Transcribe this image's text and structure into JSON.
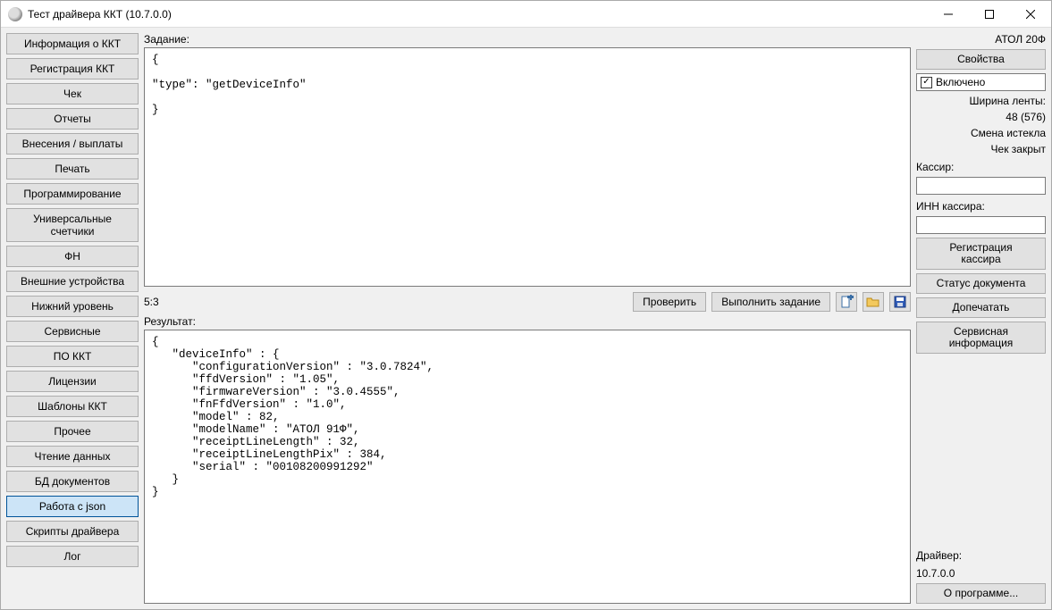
{
  "window": {
    "title": "Тест драйвера ККТ (10.7.0.0)"
  },
  "sidebar": {
    "items": [
      {
        "label": "Информация о ККТ"
      },
      {
        "label": "Регистрация ККТ"
      },
      {
        "label": "Чек"
      },
      {
        "label": "Отчеты"
      },
      {
        "label": "Внесения / выплаты"
      },
      {
        "label": "Печать"
      },
      {
        "label": "Программирование"
      },
      {
        "label": "Универсальные счетчики"
      },
      {
        "label": "ФН"
      },
      {
        "label": "Внешние устройства"
      },
      {
        "label": "Нижний уровень"
      },
      {
        "label": "Сервисные"
      },
      {
        "label": "ПО ККТ"
      },
      {
        "label": "Лицензии"
      },
      {
        "label": "Шаблоны ККТ"
      },
      {
        "label": "Прочее"
      },
      {
        "label": "Чтение данных"
      },
      {
        "label": "БД документов"
      },
      {
        "label": "Работа с json"
      },
      {
        "label": "Скрипты драйвера"
      },
      {
        "label": "Лог"
      }
    ],
    "active_index": 18
  },
  "center": {
    "task_label": "Задание:",
    "task_text": "{\n\n\"type\": \"getDeviceInfo\"\n\n}",
    "cursor_pos": "5:3",
    "validate_btn": "Проверить",
    "execute_btn": "Выполнить задание",
    "result_label": "Результат:",
    "result_text": "{\n   \"deviceInfo\" : {\n      \"configurationVersion\" : \"3.0.7824\",\n      \"ffdVersion\" : \"1.05\",\n      \"firmwareVersion\" : \"3.0.4555\",\n      \"fnFfdVersion\" : \"1.0\",\n      \"model\" : 82,\n      \"modelName\" : \"АТОЛ 91Ф\",\n      \"receiptLineLength\" : 32,\n      \"receiptLineLengthPix\" : 384,\n      \"serial\" : \"00108200991292\"\n   }\n}"
  },
  "right": {
    "device_name": "АТОЛ 20Ф",
    "properties_btn": "Свойства",
    "enabled_label": "Включено",
    "enabled_checked": true,
    "tape_width_label": "Ширина ленты:",
    "tape_width_value": "48 (576)",
    "shift_status": "Смена истекла",
    "receipt_status": "Чек закрыт",
    "cashier_label": "Кассир:",
    "cashier_inn_label": "ИНН кассира:",
    "register_cashier_btn": "Регистрация\nкассира",
    "doc_status_btn": "Статус документа",
    "reprint_btn": "Допечатать",
    "service_info_btn": "Сервисная\nинформация",
    "driver_label": "Драйвер:",
    "driver_version": "10.7.0.0",
    "about_btn": "О программе..."
  }
}
